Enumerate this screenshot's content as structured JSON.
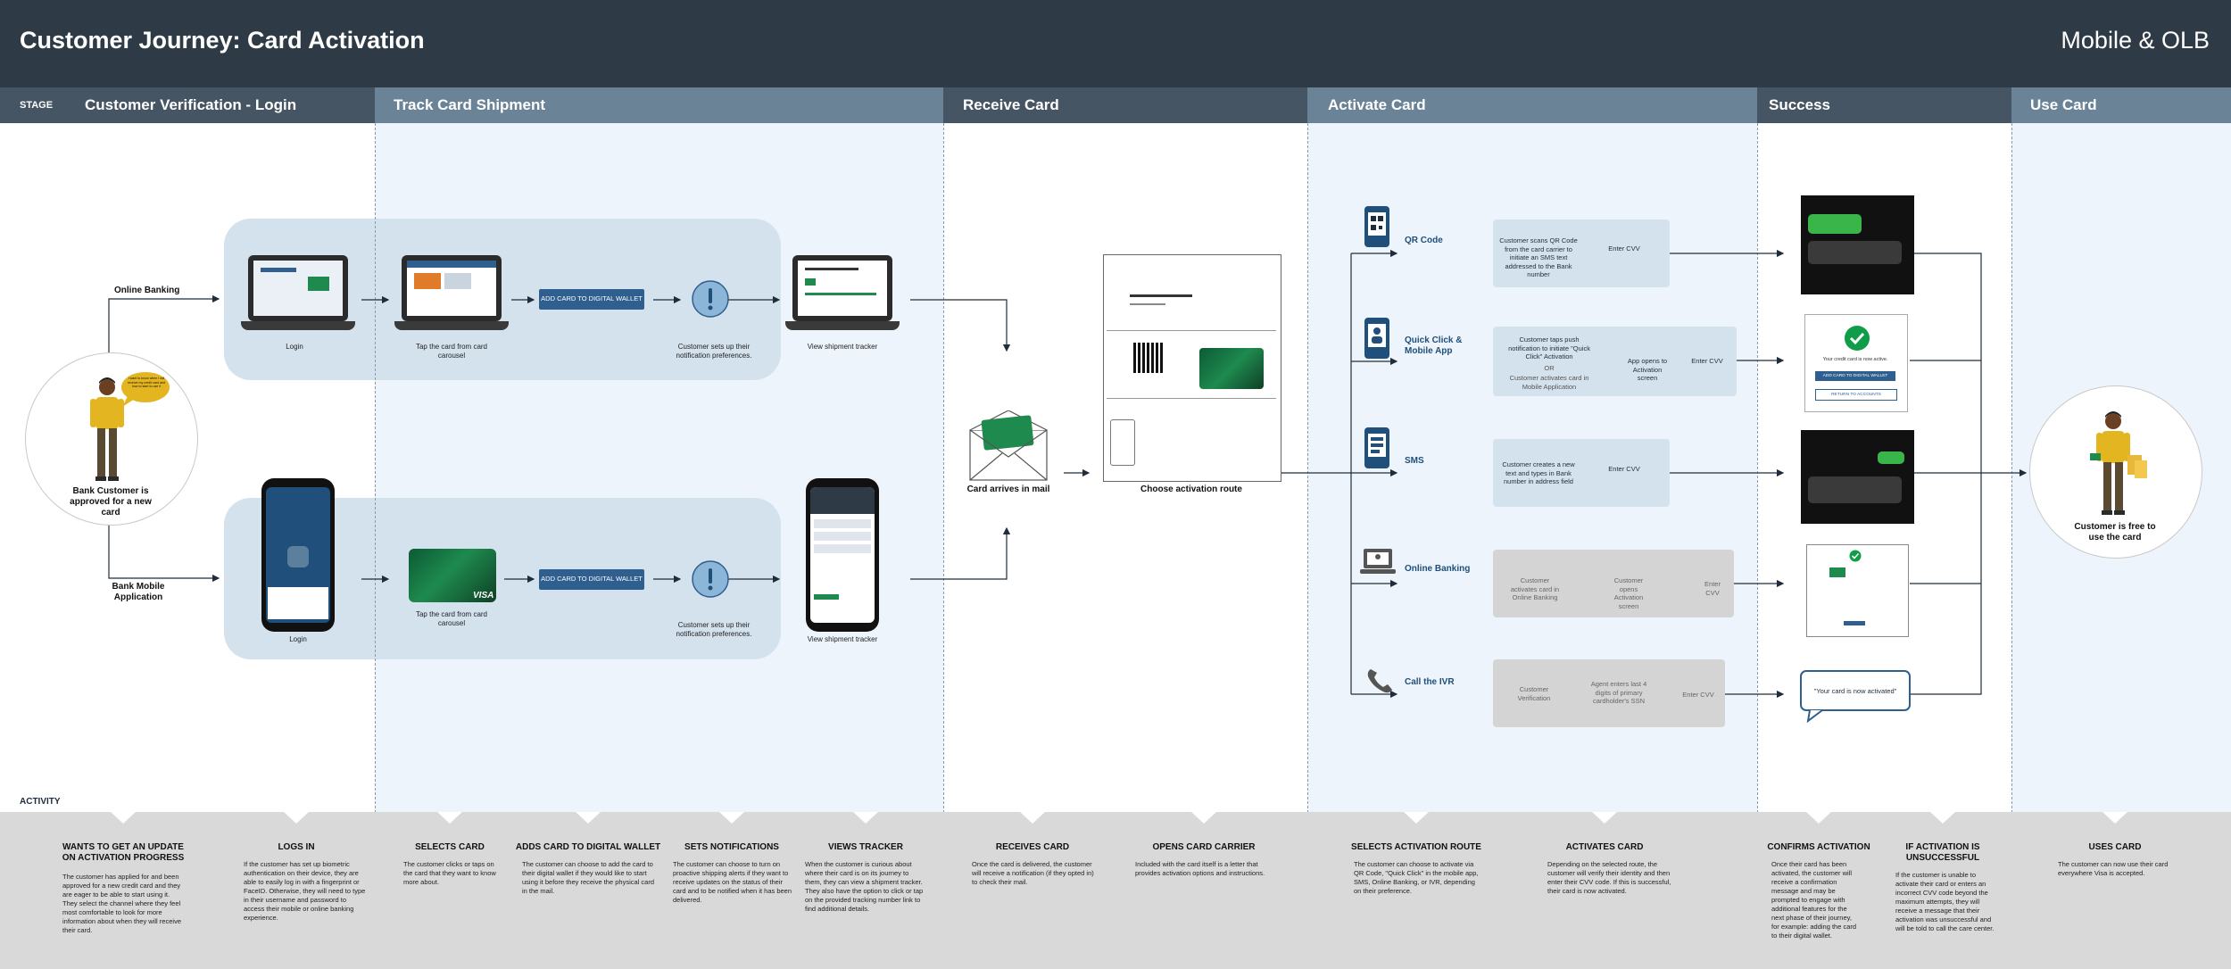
{
  "header": {
    "title": "Customer Journey: Card Activation",
    "channel": "Mobile & OLB"
  },
  "stages": {
    "keyword": "STAGE",
    "items": [
      {
        "label": "Customer Verification - Login"
      },
      {
        "label": "Track Card Shipment"
      },
      {
        "label": "Receive Card"
      },
      {
        "label": "Activate Card"
      },
      {
        "label": "Success"
      },
      {
        "label": "Use Card"
      }
    ]
  },
  "persona": {
    "speech": "I want to know when I will receive my credit card and how to start to use it",
    "caption": "Bank Customer is approved for a new card",
    "end_caption": "Customer is free to use the card"
  },
  "channels": {
    "online": "Online Banking",
    "mobile": "Bank Mobile Application"
  },
  "online_flow": {
    "login": "Login",
    "tap_card": "Tap the card from card carousel",
    "add_wallet": "ADD CARD TO DIGITAL WALLET",
    "notify": "Customer sets up their notification preferences.",
    "tracker": "View shipment tracker"
  },
  "mobile_flow": {
    "login": "Login",
    "tap_card": "Tap the card from card carousel",
    "add_wallet": "ADD CARD TO DIGITAL WALLET",
    "notify": "Customer sets up their notification preferences.",
    "tracker": "View shipment tracker",
    "card_brand": "VISA"
  },
  "receive": {
    "mail": "Card arrives in mail",
    "carrier": "Choose activation route"
  },
  "routes": {
    "qr": {
      "label": "QR Code",
      "step1": "Customer scans QR Code from the card carrier to initiate an SMS text addressed to the Bank number",
      "step2": "Enter CVV"
    },
    "quick": {
      "label": "Quick Click & Mobile App",
      "step1": "Customer taps push notification to initiate \"Quick Click\" Activation",
      "or": "OR",
      "step1b": "Customer activates card in Mobile Application",
      "step2": "App opens to Activation screen",
      "step3": "Enter CVV"
    },
    "sms": {
      "label": "SMS",
      "step1": "Customer creates a new text and types in Bank number in address field",
      "step2": "Enter CVV"
    },
    "olb": {
      "label": "Online Banking",
      "step1": "Customer activates card in Online Banking",
      "step2": "Customer opens Activation screen",
      "step3": "Enter CVV"
    },
    "ivr": {
      "label": "Call the IVR",
      "step1": "Customer Verification",
      "step2": "Agent enters last 4 digits of primary cardholder's SSN",
      "step3": "Enter CVV"
    }
  },
  "success": {
    "confirm_text": "Your credit card is now active.",
    "btn_wallet": "ADD CARD TO DIGITAL WALLET",
    "btn_return": "RETURN TO ACCOUNTS",
    "ivr_quote": "\"Your card is now activated\""
  },
  "activity": {
    "keyword": "ACTIVITY",
    "items": [
      {
        "title": "WANTS TO GET AN UPDATE ON ACTIVATION PROGRESS",
        "body": "The customer has applied for and been approved for a new credit card and they are eager to be able to start using it. They select the channel where they feel most comfortable to look for more information about when they will receive their card."
      },
      {
        "title": "LOGS IN",
        "body": "If the customer has set up biometric authentication on their device, they are able to easily log in with a fingerprint or FaceID. Otherwise, they will need to type in their username and password to access their mobile or online banking experience."
      },
      {
        "title": "SELECTS CARD",
        "body": "The customer clicks or taps on the card that they want to know more about."
      },
      {
        "title": "ADDS CARD TO DIGITAL WALLET",
        "body": "The customer can choose to add the card to their digital wallet if they would like to start using it before they receive the physical card in the mail."
      },
      {
        "title": "SETS NOTIFICATIONS",
        "body": "The customer can choose to turn on proactive shipping alerts if they want to receive updates on the status of their card and to be notified when it has been delivered."
      },
      {
        "title": "VIEWS TRACKER",
        "body": "When the customer is curious about where their card is on its journey to them, they can view a shipment tracker. They also have the option to click or tap on the provided tracking number link to find additional details."
      },
      {
        "title": "RECEIVES CARD",
        "body": "Once the card is delivered, the customer will receive a notification (if they opted in) to check their mail."
      },
      {
        "title": "OPENS CARD CARRIER",
        "body": "Included with the card itself is a letter that provides activation options and instructions."
      },
      {
        "title": "SELECTS ACTIVATION ROUTE",
        "body": "The customer can choose to activate via QR Code, \"Quick Click\" in the mobile app, SMS, Online Banking, or IVR, depending on their preference."
      },
      {
        "title": "ACTIVATES CARD",
        "body": "Depending on the selected route, the customer will verify their identity and then enter their CVV code. If this is successful, their card is now activated."
      },
      {
        "title": "CONFIRMS ACTIVATION",
        "body": "Once their card has been activated, the customer will receive a confirmation message and may be prompted to engage with additional features for the next phase of their journey, for example: adding the card to their digital wallet."
      },
      {
        "title": "IF ACTIVATION IS UNSUCCESSFUL",
        "body": "If the customer is unable to activate their card or enters an incorrect CVV code beyond the maximum attempts, they will receive a message that their activation was unsuccessful and will be told to call the care center."
      },
      {
        "title": "USES CARD",
        "body": "The customer can now use their card everywhere Visa is accepted."
      }
    ]
  },
  "colors": {
    "header": "#2e3b47",
    "stage": "#455563",
    "stage_alt": "#6b8396",
    "band": "#d4e2ee",
    "accent": "#2f5f8f",
    "success": "#0f9d4a"
  }
}
